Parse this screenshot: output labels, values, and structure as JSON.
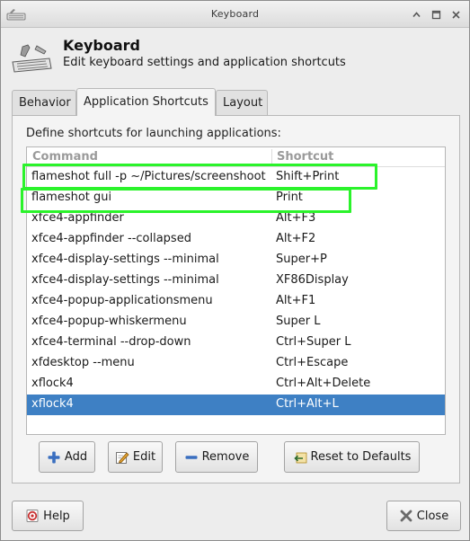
{
  "window": {
    "title": "Keyboard",
    "controls": [
      "roll-up",
      "maximize",
      "close"
    ]
  },
  "header": {
    "title": "Keyboard",
    "subtitle": "Edit keyboard settings and application shortcuts",
    "icon": "keyboard-icon"
  },
  "tabs": [
    {
      "label": "Behavior",
      "active": false
    },
    {
      "label": "Application Shortcuts",
      "active": true
    },
    {
      "label": "Layout",
      "active": false
    }
  ],
  "shortcuts": {
    "intro": "Define shortcuts for launching applications:",
    "columns": {
      "command": "Command",
      "shortcut": "Shortcut"
    },
    "rows": [
      {
        "command": "flameshot full -p ~/Pictures/screenshoot",
        "shortcut": "Shift+Print"
      },
      {
        "command": "flameshot gui",
        "shortcut": "Print"
      },
      {
        "command": "xfce4-appfinder",
        "shortcut": "Alt+F3"
      },
      {
        "command": "xfce4-appfinder --collapsed",
        "shortcut": "Alt+F2"
      },
      {
        "command": "xfce4-display-settings --minimal",
        "shortcut": "Super+P"
      },
      {
        "command": "xfce4-display-settings --minimal",
        "shortcut": "XF86Display"
      },
      {
        "command": "xfce4-popup-applicationsmenu",
        "shortcut": "Alt+F1"
      },
      {
        "command": "xfce4-popup-whiskermenu",
        "shortcut": "Super L"
      },
      {
        "command": "xfce4-terminal --drop-down",
        "shortcut": "Ctrl+Super L"
      },
      {
        "command": "xfdesktop --menu",
        "shortcut": "Ctrl+Escape"
      },
      {
        "command": "xflock4",
        "shortcut": "Ctrl+Alt+Delete"
      },
      {
        "command": "xflock4",
        "shortcut": "Ctrl+Alt+L"
      }
    ],
    "selected_index": 11
  },
  "actions": {
    "add": "Add",
    "edit": "Edit",
    "remove": "Remove",
    "reset": "Reset to Defaults"
  },
  "footer": {
    "help": "Help",
    "close": "Close"
  },
  "colors": {
    "selection": "#3e80c4",
    "highlight_box": "#2bf32b"
  }
}
